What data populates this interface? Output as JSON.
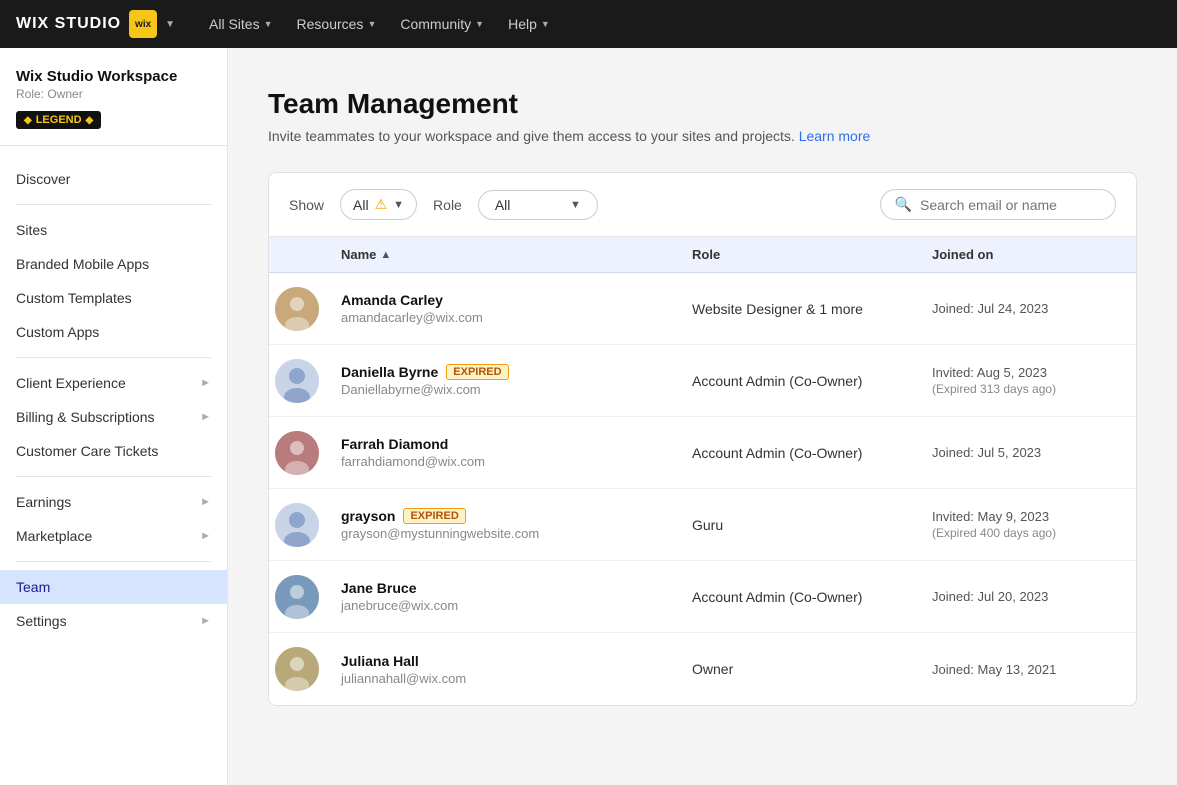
{
  "topnav": {
    "brand": "WIX STUDIO",
    "icon_label": "wix",
    "nav_items": [
      {
        "label": "All Sites",
        "has_chevron": true
      },
      {
        "label": "Resources",
        "has_chevron": true
      },
      {
        "label": "Community",
        "has_chevron": true
      },
      {
        "label": "Help",
        "has_chevron": true
      }
    ]
  },
  "sidebar": {
    "workspace_name": "Wix Studio Workspace",
    "workspace_role": "Role: Owner",
    "badge_label": "LEGEND",
    "discover_label": "Discover",
    "nav_items": [
      {
        "id": "sites",
        "label": "Sites",
        "has_chevron": false
      },
      {
        "id": "branded-mobile-apps",
        "label": "Branded Mobile Apps",
        "has_chevron": false
      },
      {
        "id": "custom-templates",
        "label": "Custom Templates",
        "has_chevron": false
      },
      {
        "id": "custom-apps",
        "label": "Custom Apps",
        "has_chevron": false
      }
    ],
    "nav_items2": [
      {
        "id": "client-experience",
        "label": "Client Experience",
        "has_chevron": true
      },
      {
        "id": "billing-subscriptions",
        "label": "Billing & Subscriptions",
        "has_chevron": true
      },
      {
        "id": "customer-care-tickets",
        "label": "Customer Care Tickets",
        "has_chevron": false
      }
    ],
    "nav_items3": [
      {
        "id": "earnings",
        "label": "Earnings",
        "has_chevron": true
      },
      {
        "id": "marketplace",
        "label": "Marketplace",
        "has_chevron": true
      }
    ],
    "nav_items4": [
      {
        "id": "team",
        "label": "Team",
        "has_chevron": false,
        "active": true
      },
      {
        "id": "settings",
        "label": "Settings",
        "has_chevron": true
      }
    ]
  },
  "page": {
    "title": "Team Management",
    "subtitle": "Invite teammates to your workspace and give them access to your sites and projects.",
    "learn_more": "Learn more"
  },
  "filters": {
    "show_label": "Show",
    "show_value": "All",
    "role_label": "Role",
    "role_value": "All",
    "search_placeholder": "Search email or name"
  },
  "table": {
    "columns": [
      {
        "id": "avatar",
        "label": ""
      },
      {
        "id": "name",
        "label": "Name",
        "sorted": true,
        "sort_dir": "asc"
      },
      {
        "id": "role",
        "label": "Role"
      },
      {
        "id": "joined",
        "label": "Joined on"
      }
    ],
    "rows": [
      {
        "id": "amanda-carley",
        "name": "Amanda Carley",
        "email": "amandacarley@wix.com",
        "role": "Website Designer & 1 more",
        "joined_primary": "Joined: Jul 24, 2023",
        "joined_secondary": "",
        "expired": false,
        "avatar_type": "photo",
        "avatar_color": "#c9b8a0",
        "avatar_initials": "AC"
      },
      {
        "id": "daniella-byrne",
        "name": "Daniella Byrne",
        "email": "Daniellabyrne@wix.com",
        "role": "Account Admin (Co-Owner)",
        "joined_primary": "Invited: Aug 5, 2023",
        "joined_secondary": "(Expired 313 days ago)",
        "expired": true,
        "avatar_type": "placeholder",
        "avatar_color": "#c9d4e8",
        "avatar_initials": "DB"
      },
      {
        "id": "farrah-diamond",
        "name": "Farrah Diamond",
        "email": "farrahdiamond@wix.com",
        "role": "Account Admin (Co-Owner)",
        "joined_primary": "Joined: Jul 5, 2023",
        "joined_secondary": "",
        "expired": false,
        "avatar_type": "photo",
        "avatar_color": "#b8a0b0",
        "avatar_initials": "FD"
      },
      {
        "id": "grayson",
        "name": "grayson",
        "email": "grayson@mystunningwebsite.com",
        "role": "Guru",
        "joined_primary": "Invited: May 9, 2023",
        "joined_secondary": "(Expired 400 days ago)",
        "expired": true,
        "avatar_type": "placeholder",
        "avatar_color": "#c9d4e8",
        "avatar_initials": "G"
      },
      {
        "id": "jane-bruce",
        "name": "Jane Bruce",
        "email": "janebruce@wix.com",
        "role": "Account Admin (Co-Owner)",
        "joined_primary": "Joined: Jul 20, 2023",
        "joined_secondary": "",
        "expired": false,
        "avatar_type": "photo",
        "avatar_color": "#a8b0c0",
        "avatar_initials": "JB"
      },
      {
        "id": "juliana-hall",
        "name": "Juliana Hall",
        "email": "juliannahall@wix.com",
        "role": "Owner",
        "joined_primary": "Joined: May 13, 2021",
        "joined_secondary": "",
        "expired": false,
        "avatar_type": "photo",
        "avatar_color": "#d4c8b0",
        "avatar_initials": "JH"
      }
    ]
  },
  "colors": {
    "accent_blue": "#2c6ef2",
    "expired_bg": "#fef3c7",
    "expired_border": "#f59e0b",
    "expired_text": "#b45309",
    "active_nav_bg": "#d6e4ff",
    "active_nav_text": "#1a1a8c",
    "header_bg": "#eef2ff"
  }
}
